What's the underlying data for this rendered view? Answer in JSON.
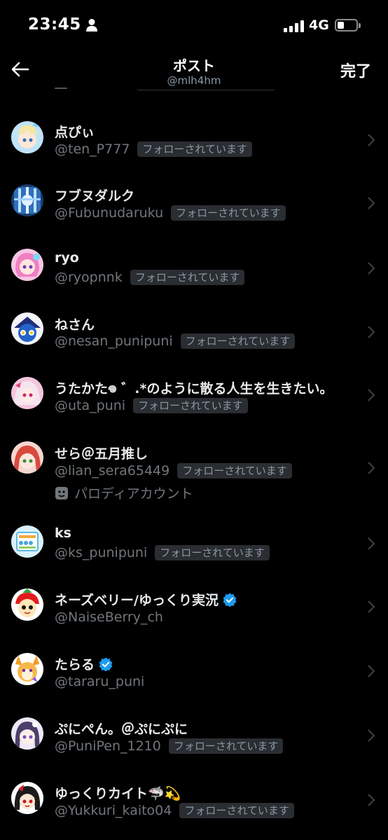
{
  "status_bar": {
    "time": "23:45",
    "network": "4G"
  },
  "header": {
    "title": "ポスト",
    "subtitle": "@mlh4hm",
    "done_label": "完了"
  },
  "users": [
    {
      "name": "点ぴぃ",
      "handle": "@ten_P777",
      "follows_you": "フォローされています",
      "verified": false
    },
    {
      "name": "フブヌダルク",
      "handle": "@Fubunudaruku",
      "follows_you": "フォローされています",
      "verified": false
    },
    {
      "name": "ryo",
      "handle": "@ryopnnk",
      "follows_you": "フォローされています",
      "verified": false
    },
    {
      "name": "ねさん",
      "handle": "@nesan_punipuni",
      "follows_you": "フォローされています",
      "verified": false
    },
    {
      "name": "うたかた𖦹 ゛.*のように散る人生を生きたい。",
      "handle": "@uta_puni",
      "follows_you": "フォローされています",
      "verified": false
    },
    {
      "name": "せら＠五月推し",
      "handle": "@lian_sera65449",
      "follows_you": "フォローされています",
      "verified": false,
      "extra": "パロディアカウント"
    },
    {
      "name": "ks",
      "handle": "@ks_punipuni",
      "follows_you": "フォローされています",
      "verified": false
    },
    {
      "name": "ネーズベリー/ゆっくり実況",
      "handle": "@NaiseBerry_ch",
      "follows_you": "",
      "verified": true
    },
    {
      "name": "たらる",
      "handle": "@tararu_puni",
      "follows_you": "",
      "verified": true
    },
    {
      "name": "ぷにぺん。＠ぷにぷに",
      "handle": "@PuniPen_1210",
      "follows_you": "フォローされています",
      "verified": false
    },
    {
      "name": "ゆっくりカイト🦈💫",
      "handle": "@Yukkuri_kaito04",
      "follows_you": "フォローされています",
      "verified": false
    }
  ],
  "colors": {
    "background": "#000000",
    "verified_blue": "#1d9bf0",
    "secondary_text": "#71767b"
  }
}
